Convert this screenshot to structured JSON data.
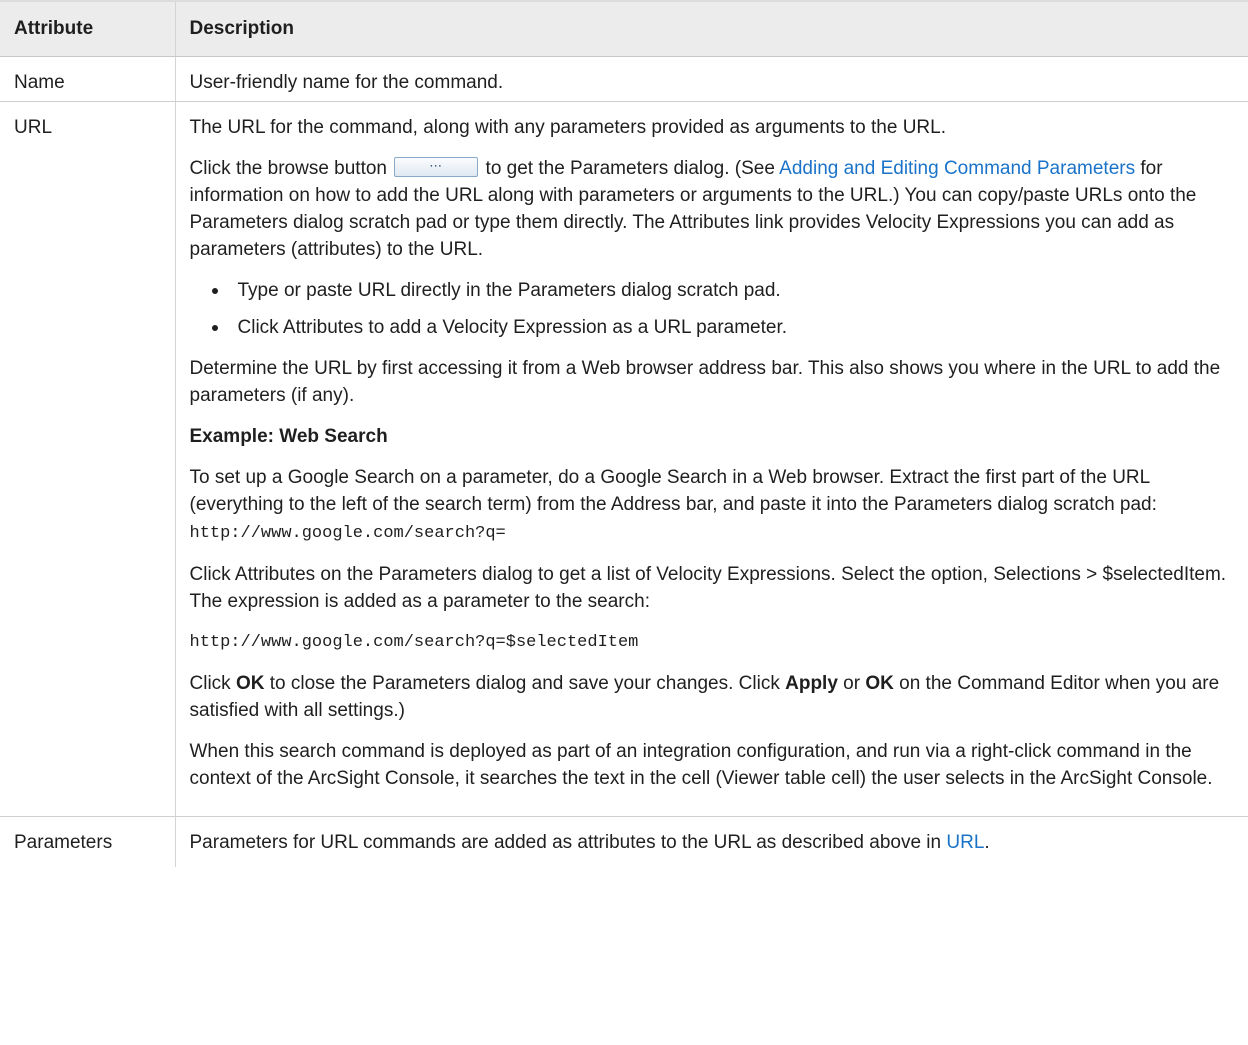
{
  "header": {
    "col1": "Attribute",
    "col2": "Description"
  },
  "rows": {
    "name": {
      "attribute": "Name",
      "description": "User-friendly name for the command."
    },
    "url": {
      "attribute": "URL",
      "p1": "The URL for the command, along with any parameters provided as arguments to the URL.",
      "p2_a": "Click the browse button ",
      "browse_button_label": "⋯",
      "p2_b": " to get the Parameters dialog. (See ",
      "p2_link": "Adding and Editing Command Parameters",
      "p2_c": " for information on how to add the URL along with parameters or arguments to the URL.) You can copy/paste URLs onto the Parameters dialog scratch pad or type them directly. The Attributes link provides Velocity Expressions you can add as parameters (attributes) to the URL.",
      "bullets": [
        "Type or paste URL directly in the Parameters dialog scratch pad.",
        "Click Attributes to add a Velocity Expression as a URL parameter."
      ],
      "p3": "Determine the URL by first accessing it from a Web browser address bar. This also shows you where in the URL to add the parameters (if any).",
      "example_heading": "Example: Web Search",
      "p4": "To set up a Google Search on a parameter, do a Google Search in a Web browser. Extract the first part of the URL (everything to the left of the search term) from the Address bar, and paste it into the Parameters dialog scratch pad: ",
      "p4_code": "http://www.google.com/search?q=",
      "p5": "Click Attributes on the Parameters dialog to get a list of Velocity Expressions. Select the option, Selections > $selectedItem. The expression is added as a parameter to the search:",
      "p6_code": "http://www.google.com/search?q=$selectedItem",
      "p7_a": "Click ",
      "p7_ok1": "OK",
      "p7_b": " to close the Parameters dialog and save your changes. Click ",
      "p7_apply": "Apply",
      "p7_c": " or ",
      "p7_ok2": "OK",
      "p7_d": " on the Command Editor when you are satisfied with all settings.)",
      "p8": "When this search command is deployed as part of an integration configuration, and run via a right-click command in the context of the ArcSight Console, it searches the text in the cell (Viewer table cell) the user selects in the ArcSight Console."
    },
    "parameters": {
      "attribute": "Parameters",
      "description_a": "Parameters for URL commands are added as attributes to the URL as described above in ",
      "description_link": "URL",
      "description_b": "."
    }
  },
  "colors": {
    "link": "#1a73c9",
    "header_bg": "#ececec"
  }
}
